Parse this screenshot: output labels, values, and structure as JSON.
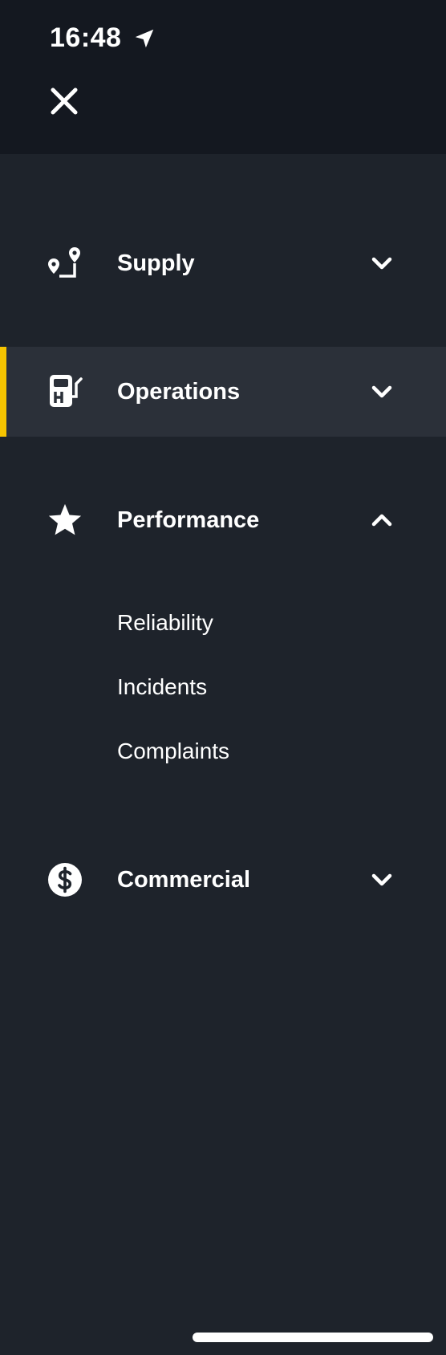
{
  "status_bar": {
    "time": "16:48",
    "location_icon": "location-arrow-icon"
  },
  "header": {
    "close_icon": "close-icon"
  },
  "menu": {
    "items": [
      {
        "label": "Supply",
        "icon": "route-pins-icon",
        "expanded": false,
        "active": false
      },
      {
        "label": "Operations",
        "icon": "fuel-pump-icon",
        "expanded": false,
        "active": true
      },
      {
        "label": "Performance",
        "icon": "star-icon",
        "expanded": true,
        "active": false,
        "children": [
          "Reliability",
          "Incidents",
          "Complaints"
        ]
      },
      {
        "label": "Commercial",
        "icon": "dollar-circle-icon",
        "expanded": false,
        "active": false
      }
    ]
  },
  "colors": {
    "background": "#1e232b",
    "topbar": "#141820",
    "active_row": "#2b3039",
    "accent": "#f6c400"
  }
}
